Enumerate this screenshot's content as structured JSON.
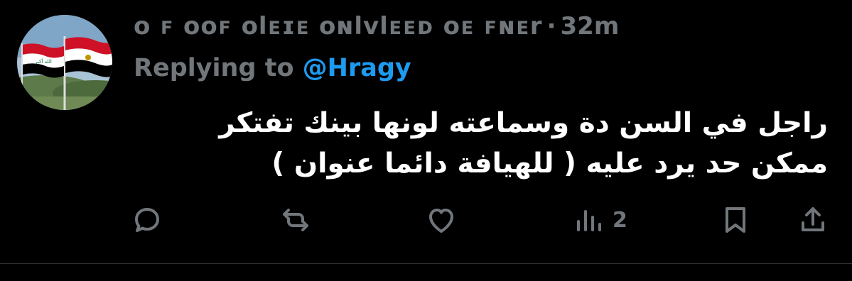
{
  "author": {
    "display_name": "ᴏ ꜰ ᴏᴏꜰ ᴏlᴇɪᴇ ᴏɴlᴠlᴇᴇᴅ ᴏᴇ ꜰɴᴇr",
    "separator": "·",
    "timestamp": "32m",
    "avatar_icon": "iraq-egypt-flags-avatar"
  },
  "reply": {
    "prefix": "Replying to",
    "handle": "@Hragy"
  },
  "tweet": {
    "lines": [
      "راجل في السن دة وسماعته لونها بينك تفتكر",
      "ممكن حد يرد عليه ( للهيافة دائما عنوان )"
    ]
  },
  "actions": {
    "reply_icon": "reply-icon",
    "retweet_icon": "retweet-icon",
    "like_icon": "heart-icon",
    "views_icon": "views-icon",
    "views_count": "2",
    "bookmark_icon": "bookmark-icon",
    "share_icon": "share-icon"
  },
  "colors": {
    "background": "#000000",
    "muted": "#71767b",
    "link": "#1d9bf0",
    "text": "#ffffff"
  }
}
